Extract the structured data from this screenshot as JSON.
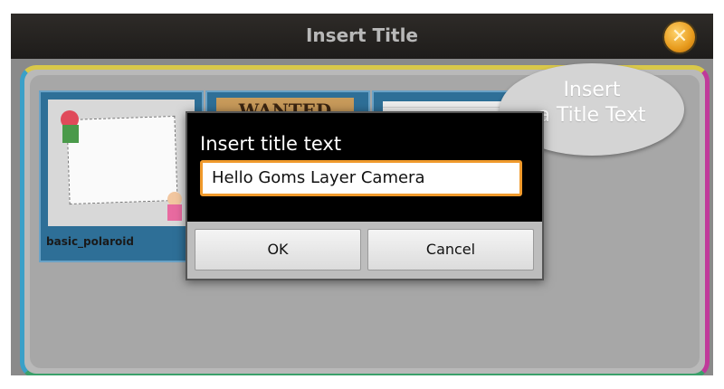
{
  "screen": {
    "title": "Insert Title",
    "close_icon": "close-icon"
  },
  "gallery": {
    "cards": [
      {
        "label": "basic_polaroid",
        "thumb": "polaroid"
      },
      {
        "label": "",
        "thumb": "wanted",
        "thumb_text": "WANTED"
      },
      {
        "label": "",
        "thumb": "document"
      }
    ]
  },
  "dialog": {
    "heading": "Insert title text",
    "input_value": "Hello Goms Layer Camera",
    "ok_label": "OK",
    "cancel_label": "Cancel",
    "accent": "#f09a2c"
  },
  "callout": {
    "line1": "Insert",
    "line2": "a Title Text"
  }
}
